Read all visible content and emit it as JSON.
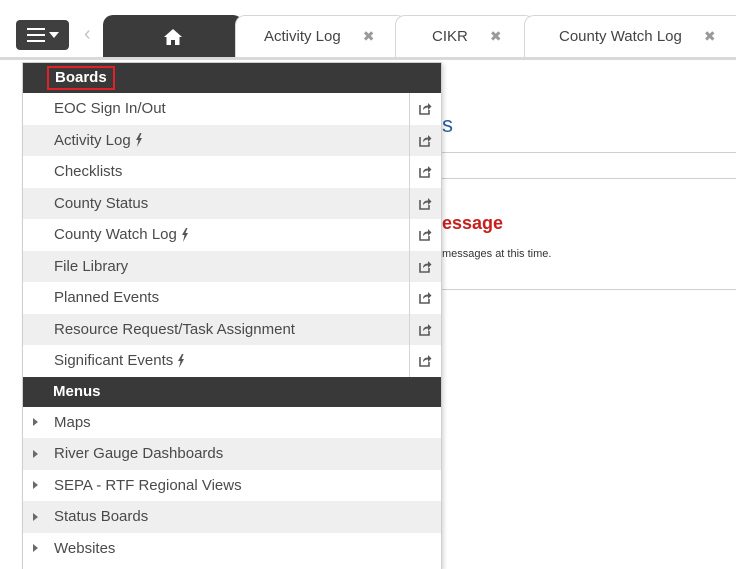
{
  "tabs": [
    {
      "label": "Activity Log",
      "closable": true
    },
    {
      "label": "CIKR",
      "closable": true
    },
    {
      "label": "County Watch Log",
      "closable": true
    }
  ],
  "close_glyph": "✖",
  "icons": {
    "menu": "hamburger-icon",
    "home": "home-icon",
    "back": "chevron-left-icon",
    "external": "external-link-icon",
    "bolt": "lightning-bolt-icon"
  },
  "background": {
    "heading_fragment": "essage",
    "text_fragment": "messages at this time.",
    "letter_fragment": "s"
  },
  "dropdown": {
    "boards_header": "Boards",
    "boards": [
      {
        "label": "EOC Sign In/Out",
        "bolt": false
      },
      {
        "label": "Activity Log",
        "bolt": true
      },
      {
        "label": "Checklists",
        "bolt": false
      },
      {
        "label": "County Status",
        "bolt": false
      },
      {
        "label": "County Watch Log",
        "bolt": true
      },
      {
        "label": "File Library",
        "bolt": false
      },
      {
        "label": "Planned Events",
        "bolt": false
      },
      {
        "label": "Resource Request/Task Assignment",
        "bolt": false
      },
      {
        "label": "Significant Events",
        "bolt": true
      }
    ],
    "menus_header": "Menus",
    "menus": [
      {
        "label": "Maps"
      },
      {
        "label": "River Gauge Dashboards"
      },
      {
        "label": "SEPA - RTF Regional Views"
      },
      {
        "label": "Status Boards"
      },
      {
        "label": "Websites"
      }
    ]
  },
  "colors": {
    "header_bg": "#393939",
    "highlight": "#e0212a",
    "alert_text": "#c81e1e"
  }
}
